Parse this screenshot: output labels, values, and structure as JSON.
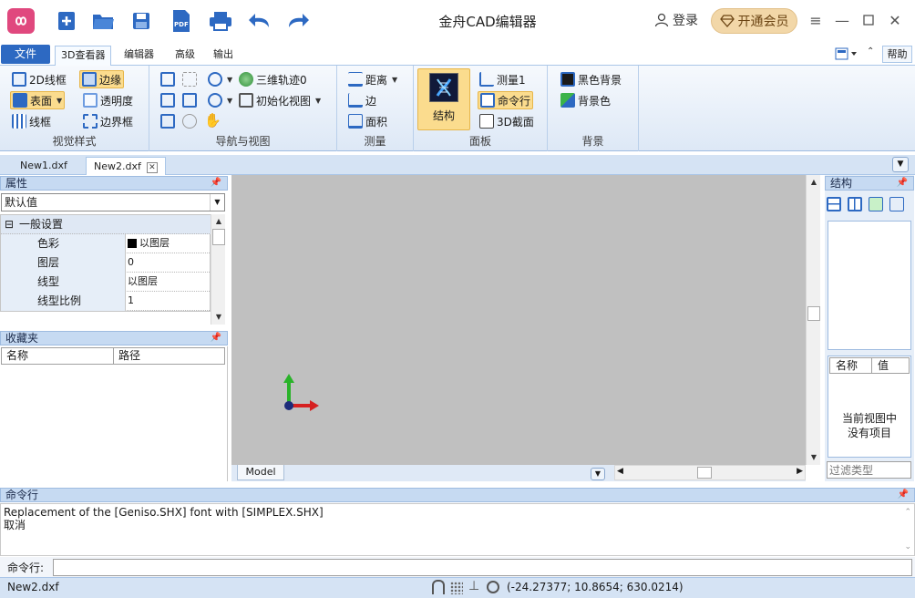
{
  "app": {
    "title": "金舟CAD编辑器",
    "login": "登录",
    "vip": "开通会员"
  },
  "ribbon_tabs": [
    "文件",
    "3D查看器",
    "编辑器",
    "高级",
    "输出"
  ],
  "help": "帮助",
  "ribbon": {
    "view_style": {
      "label": "视觉样式",
      "items": [
        "2D线框",
        "边缘",
        "表面",
        "透明度",
        "线框",
        "边界框"
      ]
    },
    "nav": {
      "label": "导航与视图",
      "orbit": "三维轨迹0",
      "init_view": "初始化视图"
    },
    "measure": {
      "label": "测量",
      "items": [
        "距离",
        "边",
        "面积"
      ]
    },
    "panel": {
      "label": "面板",
      "structure": "结构",
      "items": [
        "测量1",
        "命令行",
        "3D截面"
      ]
    },
    "background": {
      "label": "背景",
      "items": [
        "黑色背景",
        "背景色"
      ]
    }
  },
  "doc_tabs": [
    "New1.dxf",
    "New2.dxf"
  ],
  "properties": {
    "title": "属性",
    "combo": "默认值",
    "category": "一般设置",
    "rows": [
      {
        "name": "色彩",
        "value": "以图层"
      },
      {
        "name": "图层",
        "value": "0"
      },
      {
        "name": "线型",
        "value": "以图层"
      },
      {
        "name": "线型比例",
        "value": "1"
      }
    ]
  },
  "favorites": {
    "title": "收藏夹",
    "col_name": "名称",
    "col_path": "路径"
  },
  "viewport": {
    "model_tab": "Model"
  },
  "structure": {
    "title": "结构",
    "col_name": "名称",
    "col_value": "值",
    "empty_line1": "当前视图中",
    "empty_line2": "没有项目",
    "filter_placeholder": "过滤类型"
  },
  "command": {
    "title": "命令行",
    "output_lines": [
      "Replacement of the [Geniso.SHX] font with [SIMPLEX.SHX]",
      "取消"
    ],
    "input_label": "命令行:"
  },
  "status": {
    "file": "New2.dxf",
    "coords": "(-24.27377; 10.8654; 630.0214)"
  },
  "colors": {
    "accent": "#2d69c2",
    "highlight": "#fbdc8e",
    "viewport_bg": "#c0c0c0",
    "panel_head": "#c6daf2"
  }
}
